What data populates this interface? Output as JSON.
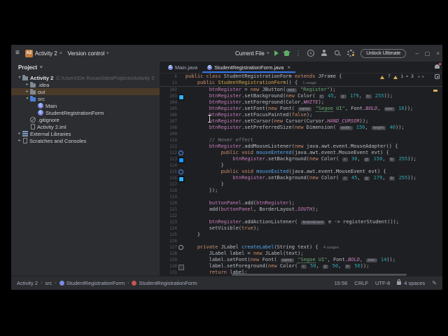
{
  "titlebar": {
    "project_badge": "A2",
    "project_name": "Activity 2",
    "vcs_label": "Version control",
    "run_config": "Current File",
    "unlock_label": "Unlock Ultimate",
    "window_buttons": {
      "minimize": "–",
      "maximize": "▢",
      "close": "×"
    }
  },
  "project_panel": {
    "header": "Project",
    "items": [
      {
        "label": "Activity 2",
        "path": "C:\\Users\\De Rosas\\IdeaProjects\\Activity 2",
        "icon": "folder",
        "chevron": "down",
        "level": 0,
        "bold": true
      },
      {
        "label": ".idea",
        "icon": "folder",
        "chevron": "right",
        "level": 1
      },
      {
        "label": "out",
        "icon": "folder",
        "chevron": "right",
        "level": 1,
        "selected": true
      },
      {
        "label": "src",
        "icon": "folder-src",
        "chevron": "down",
        "level": 1
      },
      {
        "label": "Main",
        "icon": "class",
        "level": 2
      },
      {
        "label": "StudentRegistrationForm",
        "icon": "class",
        "level": 2
      },
      {
        "label": ".gitignore",
        "icon": "ignored",
        "level": 1
      },
      {
        "label": "Activity 2.iml",
        "icon": "iml",
        "level": 1
      },
      {
        "label": "External Libraries",
        "icon": "libs",
        "chevron": "right",
        "level": 0
      },
      {
        "label": "Scratches and Consoles",
        "icon": "scratches",
        "chevron": "right",
        "level": 0
      }
    ]
  },
  "tabs": [
    {
      "label": "Main.java",
      "active": false,
      "closable": false
    },
    {
      "label": "StudentRegistrationForm.java",
      "active": true,
      "closable": true
    }
  ],
  "inspections": {
    "warnings": "7",
    "weak_warnings": "1",
    "typos": "3"
  },
  "editor": {
    "sticky_lines": [
      {
        "num": "6",
        "segs": [
          [
            "k",
            "public class "
          ],
          [
            "d",
            "StudentRegistrationForm "
          ],
          [
            "k",
            "extends "
          ],
          [
            "d",
            "JFrame {"
          ]
        ]
      },
      {
        "num": "11",
        "segs": [
          [
            "d",
            "    "
          ],
          [
            "k",
            "public "
          ],
          [
            "y",
            "StudentRegistrationForm"
          ],
          [
            "d",
            "() { "
          ],
          [
            "u",
            "1 usage"
          ]
        ]
      }
    ],
    "code_lines": [
      {
        "num": "102",
        "segs": [
          [
            "d",
            "        "
          ],
          [
            "f",
            "btnRegister"
          ],
          [
            "d",
            " = "
          ],
          [
            "k",
            "new "
          ],
          [
            "d",
            "JButton("
          ],
          [
            "h",
            "text:"
          ],
          [
            "d",
            " "
          ],
          [
            "s",
            "\"Register\""
          ],
          [
            "d",
            ");"
          ]
        ]
      },
      {
        "num": "103",
        "icon": "sw-blue",
        "segs": [
          [
            "d",
            "        "
          ],
          [
            "f",
            "btnRegister"
          ],
          [
            "d",
            ".setBackground("
          ],
          [
            "k",
            "new "
          ],
          [
            "d",
            "Color( "
          ],
          [
            "h",
            "r:"
          ],
          [
            "d",
            " "
          ],
          [
            "n",
            "45"
          ],
          [
            "d",
            ", "
          ],
          [
            "h",
            "g:"
          ],
          [
            "d",
            " "
          ],
          [
            "n",
            "179"
          ],
          [
            "d",
            ", "
          ],
          [
            "h",
            "b:"
          ],
          [
            "d",
            " "
          ],
          [
            "n",
            "255"
          ],
          [
            "d",
            "));"
          ]
        ]
      },
      {
        "num": "104",
        "segs": [
          [
            "d",
            "        "
          ],
          [
            "f",
            "btnRegister"
          ],
          [
            "d",
            ".setForeground(Color."
          ],
          [
            "c",
            "WHITE"
          ],
          [
            "d",
            ");"
          ]
        ]
      },
      {
        "num": "105",
        "segs": [
          [
            "d",
            "        "
          ],
          [
            "f",
            "btnRegister"
          ],
          [
            "d",
            ".setFont("
          ],
          [
            "k",
            "new "
          ],
          [
            "d",
            "Font( "
          ],
          [
            "h",
            "name:"
          ],
          [
            "d",
            " "
          ],
          [
            "su",
            "\"Segoe"
          ],
          [
            "s",
            " UI\""
          ],
          [
            "d",
            ", Font."
          ],
          [
            "c",
            "BOLD"
          ],
          [
            "d",
            ", "
          ],
          [
            "h",
            "size:"
          ],
          [
            "d",
            " "
          ],
          [
            "n",
            "16"
          ],
          [
            "d",
            "));"
          ]
        ]
      },
      {
        "num": "106",
        "segs": [
          [
            "d",
            "        "
          ],
          [
            "f",
            "btnRegister"
          ],
          [
            "d",
            ".setFocusPainted("
          ],
          [
            "k",
            "false"
          ],
          [
            "d",
            ");"
          ]
        ]
      },
      {
        "num": "107",
        "segs": [
          [
            "d",
            "        "
          ],
          [
            "f",
            "btnRegister"
          ],
          [
            "d",
            ".setCursor("
          ],
          [
            "k",
            "new "
          ],
          [
            "d",
            "Cursor(Cursor."
          ],
          [
            "c",
            "HAND_CURSOR"
          ],
          [
            "d",
            "));"
          ]
        ]
      },
      {
        "num": "108",
        "segs": [
          [
            "d",
            "        "
          ],
          [
            "f",
            "btnRegister"
          ],
          [
            "d",
            ".setPreferredSize("
          ],
          [
            "k",
            "new "
          ],
          [
            "d",
            "Dimension( "
          ],
          [
            "h",
            "width:"
          ],
          [
            "d",
            " "
          ],
          [
            "n",
            "150"
          ],
          [
            "d",
            ", "
          ],
          [
            "h",
            "height:"
          ],
          [
            "d",
            " "
          ],
          [
            "n",
            "40"
          ],
          [
            "d",
            "));"
          ]
        ]
      },
      {
        "num": "109",
        "segs": []
      },
      {
        "num": "110",
        "segs": [
          [
            "d",
            "        "
          ],
          [
            "cm",
            "// Hover effect"
          ]
        ]
      },
      {
        "num": "111",
        "segs": [
          [
            "d",
            "        "
          ],
          [
            "f",
            "btnRegister"
          ],
          [
            "d",
            ".addMouseListener("
          ],
          [
            "k",
            "new "
          ],
          [
            "d",
            "java.awt.event.MouseAdapter() {"
          ]
        ]
      },
      {
        "num": "112",
        "icon": "ovr",
        "segs": [
          [
            "d",
            "            "
          ],
          [
            "k",
            "public void "
          ],
          [
            "m",
            "mouseEntered"
          ],
          [
            "d",
            "(java.awt.event.MouseEvent evt) {"
          ]
        ]
      },
      {
        "num": "113",
        "icon": "sw-blue2",
        "segs": [
          [
            "d",
            "                "
          ],
          [
            "f",
            "btnRegister"
          ],
          [
            "d",
            ".setBackground("
          ],
          [
            "k",
            "new "
          ],
          [
            "d",
            "Color( "
          ],
          [
            "h",
            "r:"
          ],
          [
            "d",
            " "
          ],
          [
            "n",
            "30"
          ],
          [
            "d",
            ", "
          ],
          [
            "h",
            "g:"
          ],
          [
            "d",
            " "
          ],
          [
            "n",
            "150"
          ],
          [
            "d",
            ", "
          ],
          [
            "h",
            "b:"
          ],
          [
            "d",
            " "
          ],
          [
            "n",
            "255"
          ],
          [
            "d",
            "));"
          ]
        ]
      },
      {
        "num": "114",
        "segs": [
          [
            "d",
            "            }"
          ]
        ]
      },
      {
        "num": "115",
        "icon": "ovr",
        "segs": [
          [
            "d",
            "            "
          ],
          [
            "k",
            "public void "
          ],
          [
            "m",
            "mouseExited"
          ],
          [
            "d",
            "(java.awt.event.MouseEvent evt) {"
          ]
        ]
      },
      {
        "num": "116",
        "icon": "sw-blue",
        "segs": [
          [
            "d",
            "                "
          ],
          [
            "f",
            "btnRegister"
          ],
          [
            "d",
            ".setBackground("
          ],
          [
            "k",
            "new "
          ],
          [
            "d",
            "Color( "
          ],
          [
            "h",
            "r:"
          ],
          [
            "d",
            " "
          ],
          [
            "n",
            "45"
          ],
          [
            "d",
            ", "
          ],
          [
            "h",
            "g:"
          ],
          [
            "d",
            " "
          ],
          [
            "n",
            "179"
          ],
          [
            "d",
            ", "
          ],
          [
            "h",
            "b:"
          ],
          [
            "d",
            " "
          ],
          [
            "n",
            "255"
          ],
          [
            "d",
            "));"
          ]
        ]
      },
      {
        "num": "117",
        "segs": [
          [
            "d",
            "            }"
          ]
        ]
      },
      {
        "num": "118",
        "segs": [
          [
            "d",
            "        });"
          ]
        ]
      },
      {
        "num": "119",
        "segs": []
      },
      {
        "num": "120",
        "segs": [
          [
            "d",
            "        "
          ],
          [
            "f",
            "buttonPanel"
          ],
          [
            "d",
            ".add("
          ],
          [
            "f",
            "btnRegister"
          ],
          [
            "d",
            ");"
          ]
        ]
      },
      {
        "num": "121",
        "segs": [
          [
            "d",
            "        add("
          ],
          [
            "f",
            "buttonPanel"
          ],
          [
            "d",
            ", BorderLayout."
          ],
          [
            "c",
            "SOUTH"
          ],
          [
            "d",
            ");"
          ]
        ]
      },
      {
        "num": "122",
        "segs": []
      },
      {
        "num": "123",
        "segs": [
          [
            "d",
            "        "
          ],
          [
            "f",
            "btnRegister"
          ],
          [
            "d",
            ".addActionListener( "
          ],
          [
            "h",
            "ActionEvent"
          ],
          [
            "d",
            " e -> registerStudent());"
          ]
        ]
      },
      {
        "num": "124",
        "segs": [
          [
            "d",
            "        setVisible("
          ],
          [
            "k",
            "true"
          ],
          [
            "d",
            ");"
          ]
        ]
      },
      {
        "num": "125",
        "segs": [
          [
            "d",
            "    }"
          ]
        ]
      },
      {
        "num": "126",
        "segs": []
      },
      {
        "num": "127",
        "icon": "circ",
        "segs": [
          [
            "d",
            "    "
          ],
          [
            "k",
            "private "
          ],
          [
            "d",
            "JLabel "
          ],
          [
            "m",
            "createLabel"
          ],
          [
            "d",
            "(String text) { "
          ],
          [
            "u",
            "4 usages"
          ]
        ]
      },
      {
        "num": "128",
        "segs": [
          [
            "d",
            "        JLabel label = "
          ],
          [
            "k",
            "new "
          ],
          [
            "d",
            "JLabel(text);"
          ]
        ]
      },
      {
        "num": "129",
        "segs": [
          [
            "d",
            "        label.setFont("
          ],
          [
            "k",
            "new "
          ],
          [
            "d",
            "Font( "
          ],
          [
            "h",
            "name:"
          ],
          [
            "d",
            " "
          ],
          [
            "su",
            "\"Segoe"
          ],
          [
            "s",
            " UI\""
          ],
          [
            "d",
            ", Font."
          ],
          [
            "c",
            "BOLD"
          ],
          [
            "d",
            ", "
          ],
          [
            "h",
            "size:"
          ],
          [
            "d",
            " "
          ],
          [
            "n",
            "14"
          ],
          [
            "d",
            "));"
          ]
        ]
      },
      {
        "num": "130",
        "icon": "sw-grey",
        "segs": [
          [
            "d",
            "        label.setForeground("
          ],
          [
            "k",
            "new "
          ],
          [
            "d",
            "Color( "
          ],
          [
            "h",
            "r:"
          ],
          [
            "d",
            " "
          ],
          [
            "n",
            "50"
          ],
          [
            "d",
            ", "
          ],
          [
            "h",
            "g:"
          ],
          [
            "d",
            " "
          ],
          [
            "n",
            "50"
          ],
          [
            "d",
            ", "
          ],
          [
            "h",
            "b:"
          ],
          [
            "d",
            " "
          ],
          [
            "n",
            "50"
          ],
          [
            "d",
            "));"
          ]
        ]
      },
      {
        "num": "131",
        "segs": [
          [
            "d",
            "        "
          ],
          [
            "k",
            "return"
          ],
          [
            "d",
            " label;"
          ]
        ]
      }
    ]
  },
  "status_bar": {
    "breadcrumbs": [
      {
        "label": "Activity 2"
      },
      {
        "label": "src"
      },
      {
        "label": "StudentRegistrationForm",
        "icon": "class"
      },
      {
        "label": "StudentRegistrationForm",
        "icon": "method"
      }
    ],
    "position": "15:56",
    "line_ending": "CRLF",
    "encoding": "UTF-8",
    "indent": "4 spaces"
  },
  "colors": {
    "accent": "#3574F0",
    "warning": "#D6AE58",
    "editor_bg": "#1E1F22",
    "panel_bg": "#2B2D30",
    "selection_out_row": "#4A3B28",
    "color_swatch_103": "#2DB3FF",
    "color_swatch_113": "#1E96FF",
    "color_swatch_130": "#323232"
  }
}
